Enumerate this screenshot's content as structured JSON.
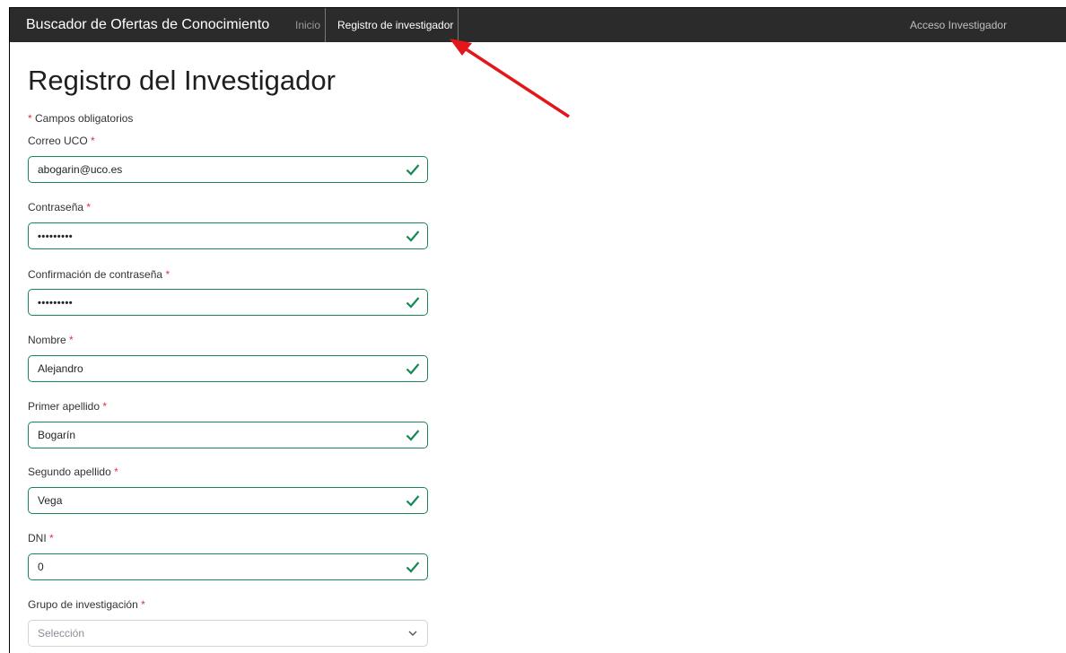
{
  "navbar": {
    "brand": "Buscador de Ofertas de Conocimiento",
    "links": [
      {
        "label": "Inicio"
      },
      {
        "label": "Registro de investigador"
      }
    ],
    "right_link": "Acceso Investigador"
  },
  "form": {
    "title": "Registro del Investigador",
    "required_mark": "*",
    "required_note": "Campos obligatorios",
    "fields": [
      {
        "label": "Correo UCO",
        "value": "abogarin@uco.es"
      },
      {
        "label": "Contraseña",
        "value": "•••••••••"
      },
      {
        "label": "Confirmación de contraseña",
        "value": "•••••••••"
      },
      {
        "label": "Nombre",
        "value": "Alejandro"
      },
      {
        "label": "Primer apellido",
        "value": "Bogarín"
      },
      {
        "label": "Segundo apellido",
        "value": "Vega"
      },
      {
        "label": "DNI",
        "value": "0"
      }
    ],
    "group": {
      "label": "Grupo de investigación",
      "placeholder": "Selección"
    }
  },
  "colors": {
    "valid": "#198754",
    "required": "#dc3545",
    "navbar": "#2b2b2b",
    "annotation_arrow": "#e3161b"
  },
  "icons": {
    "valid": "check-icon",
    "select": "chevron-down-icon",
    "annotation": "red-arrow-annotation"
  }
}
